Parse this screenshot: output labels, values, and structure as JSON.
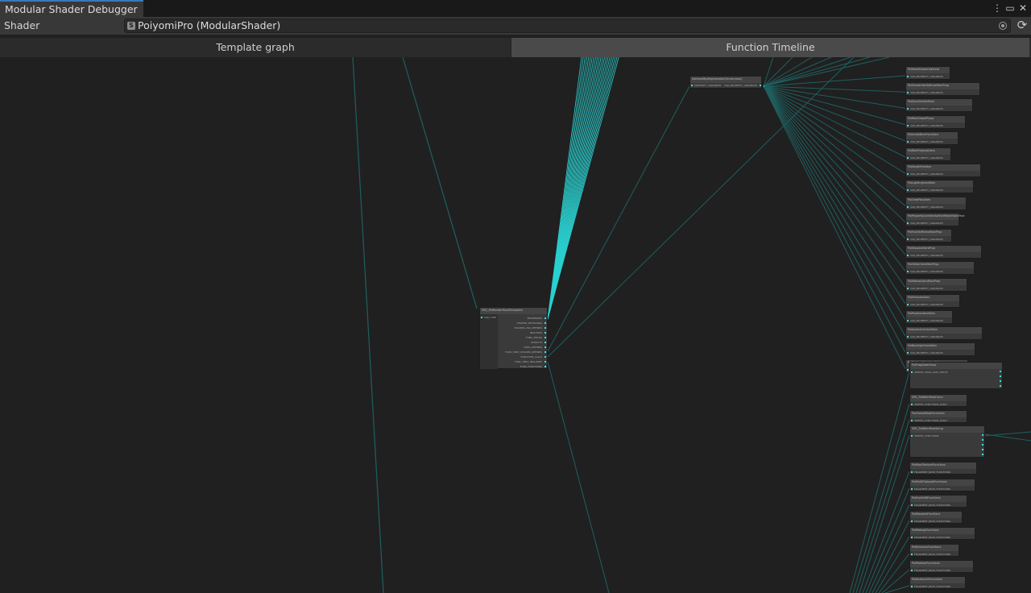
{
  "window": {
    "tab_title": "Modular Shader Debugger",
    "menu_icon": "more-vert-icon",
    "maximize_icon": "maximize-icon",
    "close_icon": "close-icon"
  },
  "shader": {
    "label": "Shader",
    "value": "PoiyomiPro (ModularShader)",
    "asset_icon_letter": "S",
    "picker_icon": "object-picker-icon",
    "refresh_icon": "refresh-icon"
  },
  "tabs": [
    {
      "label": "Template graph",
      "active": false
    },
    {
      "label": "Function Timeline",
      "active": true
    }
  ],
  "colors": {
    "background": "#202020",
    "edge": "#1f5f5f",
    "edge_bright": "#2ad0d0",
    "port": "#38e0e0",
    "active_tab": "#4a4a4a",
    "title_accent": "#3a79bb"
  },
  "graph": {
    "left_node": {
      "title": "VRC_PoiRenderMod(Template)",
      "input": "VAR_TYPE",
      "outputs": [
        "PROPERTIES",
        "SHADER_KEYWORDS",
        "SHADER_VAR_DEFINES",
        "INCLUDES",
        "FUNC_FIELDS",
        "STRUCTS",
        "FUNC_DEFINES",
        "FUNC_MELT_SHADER_DEFINES",
        "FUNCTION_CALLS",
        "FUNC_MELT_INCLUDES",
        "FUNC_FUNCTIONS"
      ]
    },
    "top_node": {
      "title": "AddressMipMapVariable(Uncommon)",
      "input": "PROPERTY_VARIABLES",
      "output": "VAR_PROPERTY_VARIABLES"
    },
    "right_nodes": [
      {
        "title": "PoiNodeShaderAddress",
        "port": "VAR_PROPERTY_VARIABLES"
      },
      {
        "title": "PoiShaderVarDefinesMainProp",
        "port": "VAR_PROPERTY_VARIABLES"
      },
      {
        "title": "PoiDecalVarDefines",
        "port": "VAR_PROPERTY_VARIABLES"
      },
      {
        "title": "PoiRoleGlobalProps",
        "port": "VAR_PROPERTY_VARIABLES"
      },
      {
        "title": "PoiInsideBackFaceVars",
        "port": "VAR_PROPERTY_VARIABLES"
      },
      {
        "title": "PoiRoleFlipbookVars",
        "port": "VAR_PROPERTY_VARIABLES"
      },
      {
        "title": "PoiDepthRimVars",
        "port": "VAR_PROPERTY_VARIABLES"
      },
      {
        "title": "PoiLightingVarsMain",
        "port": "VAR_PROPERTY_VARIABLES"
      },
      {
        "title": "PoiGrabPassVars",
        "port": "VAR_PROPERTY_VARIABLES"
      },
      {
        "title": "PoiPropertyLineVarsSwitchHelperVarsPost",
        "port": "VAR_PROPERTY_VARIABLES"
      },
      {
        "title": "PoiHueShiftVarsMainProp",
        "port": "VAR_PROPERTY_VARIABLES"
      },
      {
        "title": "PoiDissolveVarsProp",
        "port": "VAR_PROPERTY_VARIABLES"
      },
      {
        "title": "PoiGlitterVarsMainProp",
        "port": "VAR_PROPERTY_VARIABLES"
      },
      {
        "title": "PoiMatcapVarsMainProp",
        "port": "VAR_PROPERTY_VARIABLES"
      },
      {
        "title": "PoiEmissionVars",
        "port": "VAR_PROPERTY_VARIABLES"
      },
      {
        "title": "PoiParallaxVarsMain",
        "port": "VAR_PROPERTY_VARIABLES"
      },
      {
        "title": "PoiAudioLinkVarsMain",
        "port": "VAR_PROPERTY_VARIABLES"
      },
      {
        "title": "PoiBacklightVarsMain",
        "port": "VAR_PROPERTY_VARIABLES"
      },
      {
        "title": "PoiStylizedSpecVarsMain",
        "port": "VAR_PROPERTY_VARIABLES"
      }
    ],
    "function_nodes": [
      {
        "title": "PoiFragDataSetup",
        "port": "VERTEX_FRAG_DATA_SETUP"
      },
      {
        "title": "VRC_PoiMainPassFuncs",
        "port": "VERTEX_FUNCTIONS_EARLY"
      },
      {
        "title": "PoiGlobalMaskFunctions",
        "port": "VERTEX_FUNCTIONS_EARLY"
      },
      {
        "title": "VRC_PoiMainPassSetup",
        "port": "VERTEX_FUNCTIONS"
      },
      {
        "title": "PoiMainTextureFunctions",
        "port": "FRAGMENT_BASE_FUNCTIONS"
      },
      {
        "title": "PoiMultiFlipbookFunctions",
        "port": "FRAGMENT_BASE_FUNCTIONS"
      },
      {
        "title": "PoiHueShiftFunctions",
        "port": "FRAGMENT_BASE_FUNCTIONS"
      },
      {
        "title": "PoiDissolveFunctions",
        "port": "FRAGMENT_BASE_FUNCTIONS"
      },
      {
        "title": "PoiMatcapFunctions",
        "port": "FRAGMENT_BASE_FUNCTIONS"
      },
      {
        "title": "PoiEmissionFunctions",
        "port": "FRAGMENT_BASE_FUNCTIONS"
      },
      {
        "title": "PoiParallaxFunctions",
        "port": "FRAGMENT_BASE_FUNCTIONS"
      },
      {
        "title": "PoiAudioLinkFunctions",
        "port": "FRAGMENT_BASE_FUNCTIONS"
      }
    ]
  }
}
